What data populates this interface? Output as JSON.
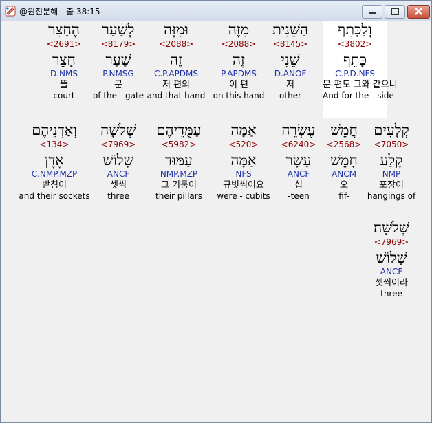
{
  "window": {
    "title": "@원전분해 - 출 38:15",
    "icons": {
      "app": "app-icon",
      "minimize": "minimize-icon",
      "maximize": "maximize-icon",
      "close": "close-icon"
    }
  },
  "colors": {
    "strong": "#8b0000",
    "morph": "#1c2fa6",
    "selected_bg": "#ffffff",
    "bg": "#f0f0f0"
  },
  "words": [
    {
      "heb": "וְלַכָּתֵף",
      "strong": "<3802>",
      "lemma": "כָּתֵף",
      "morph": "C.P.D.NFS",
      "kor": "문-편도 그와 같으니",
      "eng": "And for the - side",
      "selected": true
    },
    {
      "heb": "הַשֵּׁנִית",
      "strong": "<8145>",
      "lemma": "שֵׁנִי",
      "morph": "D.ANOF",
      "kor": "저",
      "eng": "other"
    },
    {
      "heb": "מִזֶּה",
      "strong": "<2088>",
      "lemma": "זֶה",
      "morph": "P.APDMS",
      "kor": "이 편",
      "eng": "on this hand"
    },
    {
      "heb": "וּמִזֶּה",
      "strong": "<2088>",
      "lemma": "זֶה",
      "morph": "C.P.APDMS",
      "kor": "저 편의",
      "eng": "and that hand"
    },
    {
      "heb": "לְשַׁעַר",
      "strong": "<8179>",
      "lemma": "שַׁעַר",
      "morph": "P.NMSG",
      "kor": "문",
      "eng": "of the - gate"
    },
    {
      "heb": "הֶחָצֵר",
      "strong": "<2691>",
      "lemma": "חָצֵר",
      "morph": "D.NMS",
      "kor": "뜰",
      "eng": "court"
    },
    {
      "heb": "קְלָעִים",
      "strong": "<7050>",
      "lemma": "קֶלַע",
      "morph": "NMP",
      "kor": "포장이",
      "eng": "hangings of"
    },
    {
      "heb": "חֲמֵשׁ",
      "strong": "<2568>",
      "lemma": "חָמֵשׁ",
      "morph": "ANCM",
      "kor": "오",
      "eng": "fif-"
    },
    {
      "heb": "עֶשְׂרֵה",
      "strong": "<6240>",
      "lemma": "עָשָׂר",
      "morph": "ANCF",
      "kor": "십",
      "eng": "-teen"
    },
    {
      "heb": "אַמָּה",
      "strong": "<520>",
      "lemma": "אַמָּה",
      "morph": "NFS",
      "kor": "규빗씩이요",
      "eng": "were - cubits"
    },
    {
      "heb": "עַמֻּדֵיהֶם",
      "strong": "<5982>",
      "lemma": "עַמּוּד",
      "morph": "NMP.MZP",
      "kor": "그 기둥이",
      "eng": "their pillars"
    },
    {
      "heb": "שְׁלֹשָׁה",
      "strong": "<7969>",
      "lemma": "שָׁלוֹשׁ",
      "morph": "ANCF",
      "kor": "셋씩",
      "eng": "three"
    },
    {
      "heb": "וְאַדְנֵיהֶם",
      "strong": "<134>",
      "lemma": "אֶדֶן",
      "morph": "C.NMP.MZP",
      "kor": "받침이",
      "eng": "and their sockets"
    },
    {
      "heb": "שְׁלֹשָׁה׃",
      "strong": "<7969>",
      "lemma": "שָׁלוֹשׁ",
      "morph": "ANCF",
      "kor": "셋씩이라",
      "eng": "three"
    }
  ]
}
